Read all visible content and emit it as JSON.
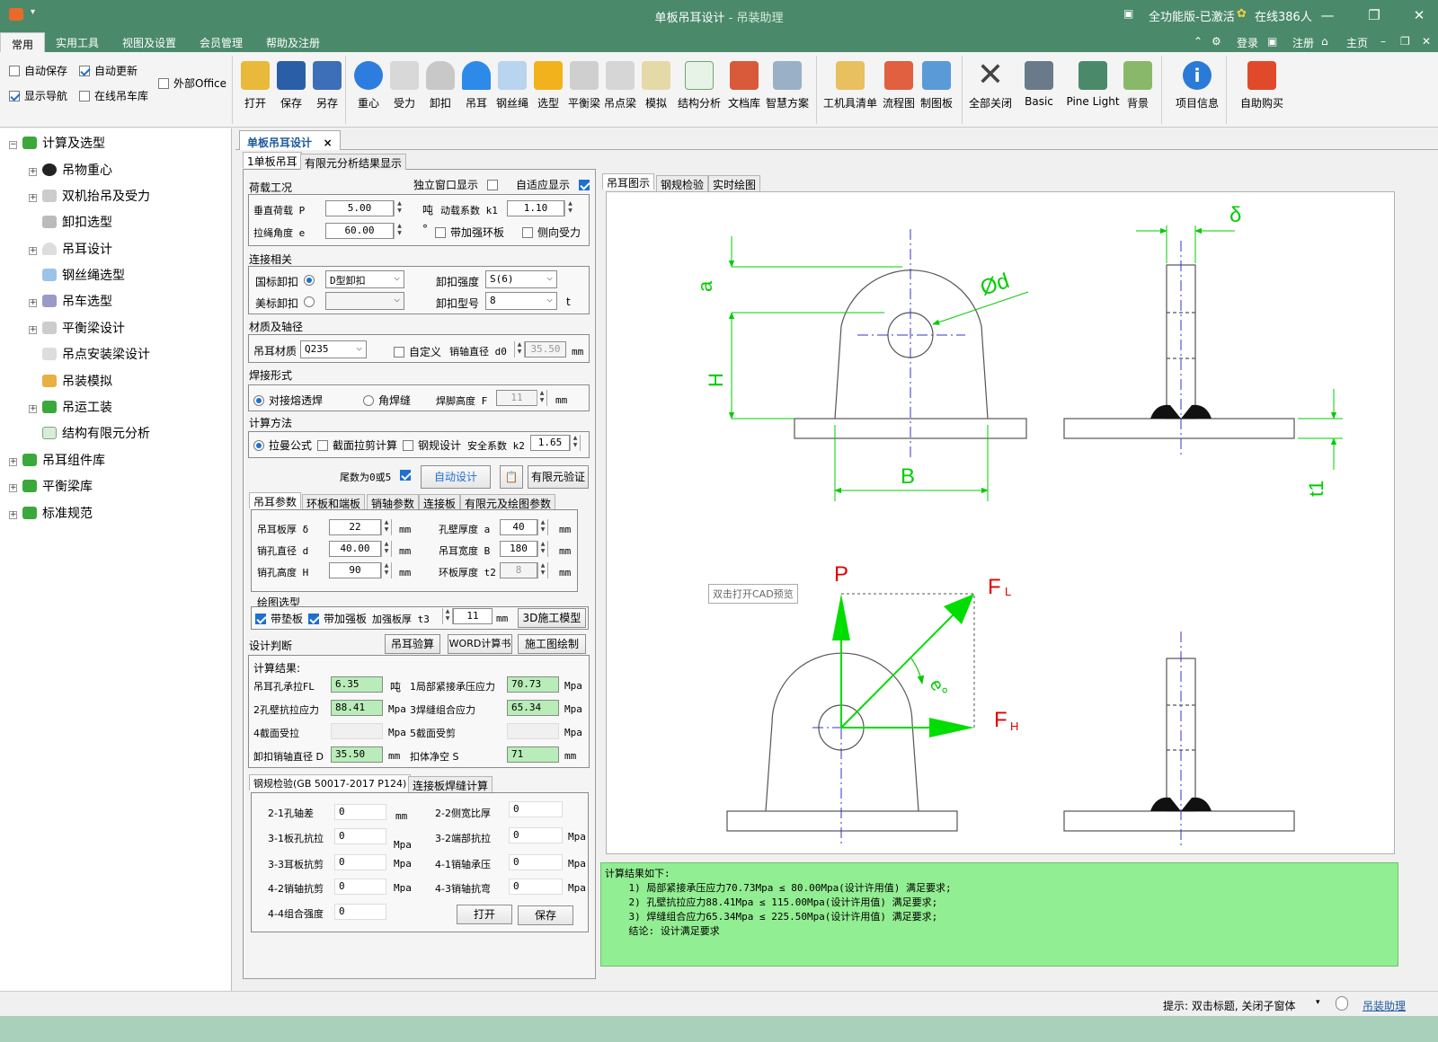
{
  "window": {
    "title": "单板吊耳设计",
    "subtitle": " - 吊装助理",
    "license": "全功能版-已激活",
    "online": "在线386人"
  },
  "menu": {
    "items": [
      "常用",
      "实用工具",
      "视图及设置",
      "会员管理",
      "帮助及注册"
    ],
    "right": [
      "登录",
      "注册",
      "主页"
    ]
  },
  "ribbon": {
    "checks": [
      {
        "label": "自动保存",
        "checked": false
      },
      {
        "label": "自动更新",
        "checked": true
      },
      {
        "label": "外部Office",
        "checked": false
      },
      {
        "label": "显示导航",
        "checked": true
      },
      {
        "label": "在线吊车库",
        "checked": false
      }
    ],
    "buttons": [
      "打开",
      "保存",
      "另存",
      "重心",
      "受力",
      "卸扣",
      "吊耳",
      "钢丝绳",
      "选型",
      "平衡梁",
      "吊点梁",
      "模拟",
      "结构分析",
      "文档库",
      "智慧方案",
      "工机具清单",
      "流程图",
      "制图板",
      "全部关闭",
      "Basic",
      "Pine Light",
      "背景",
      "项目信息",
      "自助购买"
    ]
  },
  "tree": [
    "计算及选型",
    "吊物重心",
    "双机抬吊及受力",
    "卸扣选型",
    "吊耳设计",
    "钢丝绳选型",
    "吊车选型",
    "平衡梁设计",
    "吊点安装梁设计",
    "吊装模拟",
    "吊运工装",
    "结构有限元分析",
    "吊耳组件库",
    "平衡梁库",
    "标准规范"
  ],
  "doc_tab": "单板吊耳设计",
  "inner_tabs": [
    "1单板吊耳",
    "有限元分析结果显示"
  ],
  "load": {
    "title": "荷载工况",
    "standalone": "独立窗口显示",
    "adaptive": "自适应显示",
    "p_label": "垂直荷载 P",
    "p_value": "5.00",
    "p_unit": "吨",
    "k1_label": "动载系数 k1",
    "k1_value": "1.10",
    "e_label": "拉绳角度 e",
    "e_value": "60.00",
    "e_unit": "°",
    "rib": "带加强环板",
    "side": "侧向受力"
  },
  "conn": {
    "title": "连接相关",
    "gb": "国标卸扣",
    "gb_type": "D型卸扣",
    "strength_label": "卸扣强度",
    "strength_value": "S(6)",
    "us": "美标卸扣",
    "model_label": "卸扣型号",
    "model_value": "8",
    "model_unit": "t"
  },
  "mat": {
    "title": "材质及轴径",
    "label": "吊耳材质",
    "value": "Q235",
    "custom": "自定义",
    "pin_label": "销轴直径 d0",
    "pin_value": "35.50",
    "pin_unit": "mm"
  },
  "weld": {
    "title": "焊接形式",
    "opt1": "对接熔透焊",
    "opt2": "角焊缝",
    "h_label": "焊脚高度 F",
    "h_value": "11",
    "h_unit": "mm"
  },
  "calc": {
    "title": "计算方法",
    "opt1": "拉曼公式",
    "opt2": "截面拉剪计算",
    "opt3": "钢规设计",
    "k2_label": "安全系数 k2",
    "k2_value": "1.65"
  },
  "actions": {
    "tail": "尾数为0或5",
    "auto": "自动设计",
    "fem": "有限元验证"
  },
  "param_tabs": [
    "吊耳参数",
    "环板和端板",
    "销轴参数",
    "连接板",
    "有限元及绘图参数"
  ],
  "params": [
    {
      "label": "吊耳板厚 δ",
      "value": "22",
      "unit": "mm"
    },
    {
      "label": "孔壁厚度 a",
      "value": "40",
      "unit": "mm"
    },
    {
      "label": "销孔直径 d",
      "value": "40.00",
      "unit": "mm"
    },
    {
      "label": "吊耳宽度 B",
      "value": "180",
      "unit": "mm"
    },
    {
      "label": "销孔高度 H",
      "value": "90",
      "unit": "mm"
    },
    {
      "label": "环板厚度 t2",
      "value": "8",
      "unit": "mm"
    }
  ],
  "drawing": {
    "title": "绘图选型",
    "pad": "带垫板",
    "rib": "带加强板",
    "t3_label": "加强板厚 t3",
    "t3_value": "11",
    "t3_unit": "mm",
    "model3d": "3D施工模型"
  },
  "judge": {
    "title": "设计判断",
    "check": "吊耳验算",
    "word": "WORD计算书",
    "cad": "施工图绘制"
  },
  "results": {
    "title": "计算结果:",
    "rows": [
      {
        "l1": "吊耳孔承拉FL",
        "v1": "6.35",
        "u1": "吨",
        "l2": "1局部紧接承压应力",
        "v2": "70.73",
        "u2": "Mpa"
      },
      {
        "l1": "2孔壁抗拉应力",
        "v1": "88.41",
        "u1": "Mpa",
        "l2": "3焊缝组合应力",
        "v2": "65.34",
        "u2": "Mpa"
      },
      {
        "l1": "4截面受拉",
        "v1": "",
        "u1": "Mpa",
        "l2": "5截面受剪",
        "v2": "",
        "u2": "Mpa"
      },
      {
        "l1": "卸扣销轴直径 D",
        "v1": "35.50",
        "u1": "mm",
        "l2": "扣体净空 S",
        "v2": "71",
        "u2": "mm"
      }
    ]
  },
  "steel_tabs": [
    "钢规检验(GB 50017-2017 P124)",
    "连接板焊缝计算"
  ],
  "steel": [
    {
      "l1": "2-1孔轴差",
      "v1": "0",
      "u1": "mm",
      "l2": "2-2侧宽比厚",
      "v2": "0",
      "u2": ""
    },
    {
      "l1": "3-1板孔抗拉",
      "v1": "0",
      "u1": "Mpa",
      "l2": "3-2端部抗拉",
      "v2": "0",
      "u2": "Mpa"
    },
    {
      "l1": "3-3耳板抗剪",
      "v1": "0",
      "u1": "Mpa",
      "l2": "4-1销轴承压",
      "v2": "0",
      "u2": "Mpa"
    },
    {
      "l1": "4-2销轴抗剪",
      "v1": "0",
      "u1": "Mpa",
      "l2": "4-3销轴抗弯",
      "v2": "0",
      "u2": "Mpa"
    }
  ],
  "steel_last": {
    "label": "4-4组合强度",
    "value": "0",
    "open": "打开",
    "save": "保存"
  },
  "view_tabs": [
    "吊耳图示",
    "钢规检验",
    "实时绘图"
  ],
  "figure": {
    "a": "a",
    "d": "Ød",
    "delta": "δ",
    "H": "H",
    "B": "B",
    "t1": "t1",
    "P": "P",
    "FL": "F",
    "FL_sub": "L",
    "FH": "F",
    "FH_sub": "H",
    "e": "e°",
    "tooltip": "双击打开CAD预览"
  },
  "result_text": "计算结果如下:\n    1) 局部紧接承压应力70.73Mpa ≤ 80.00Mpa(设计许用值) 满足要求;\n    2) 孔壁抗拉应力88.41Mpa ≤ 115.00Mpa(设计许用值) 满足要求;\n    3) 焊缝组合应力65.34Mpa ≤ 225.50Mpa(设计许用值) 满足要求;\n    结论: 设计满足要求",
  "status": {
    "hint": "提示: 双击标题, 关闭子窗体",
    "link": "吊装助理"
  },
  "colors": {
    "green_field": "#b8ecb8",
    "result_bg": "#92ee92",
    "title_bar": "#4a8a6a",
    "dim_green": "#00dd00",
    "force_red": "#e00000"
  }
}
